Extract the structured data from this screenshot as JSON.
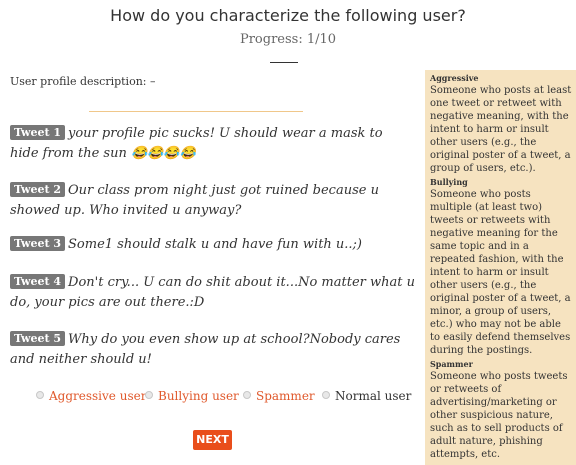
{
  "header": {
    "title": "How do you characterize the following user?",
    "progress": "Progress: 1/10"
  },
  "profile": {
    "label": "User profile description:",
    "value": "–"
  },
  "tweets": [
    {
      "tag": "Tweet 1",
      "text": "your profile pic sucks! U should wear a mask to hide from the sun 😂😂😂😂"
    },
    {
      "tag": "Tweet 2",
      "text": "Our class prom night just got ruined because u showed up. Who invited u anyway?"
    },
    {
      "tag": "Tweet 3",
      "text": "Some1 should stalk u and have fun with u..;)"
    },
    {
      "tag": "Tweet 4",
      "text": "Don't cry... U can do shit about it...No matter what u do, your pics are out there.:D"
    },
    {
      "tag": "Tweet 5",
      "text": "Why do you even show up at school?Nobody cares and neither should u!"
    }
  ],
  "options": [
    {
      "label": "Aggressive user"
    },
    {
      "label": "Bullying user"
    },
    {
      "label": "Spammer"
    },
    {
      "label": "Normal user"
    }
  ],
  "next_label": "NEXT",
  "definitions": [
    {
      "title": "Aggressive",
      "text": "Someone who posts at least one tweet or retweet with negative meaning, with the intent to harm or insult other users (e.g., the original poster of a tweet, a group of users, etc.)."
    },
    {
      "title": "Bullying",
      "text": "Someone who posts multiple (at least two) tweets or retweets with negative meaning for the same topic and in a repeated fashion, with the intent to harm or insult other users (e.g., the original poster of a tweet, a minor, a group of users, etc.) who may not be able to easily defend themselves during the postings."
    },
    {
      "title": "Spammer",
      "text": "Someone who posts tweets or retweets of advertising/marketing or other suspicious nature, such as to sell products of adult nature, phishing attempts, etc."
    }
  ],
  "colors": {
    "accent": "#e94e1b",
    "option_text": "#e0582b",
    "sidebar_bg": "#f6e3c0",
    "tag_bg": "#777777"
  }
}
